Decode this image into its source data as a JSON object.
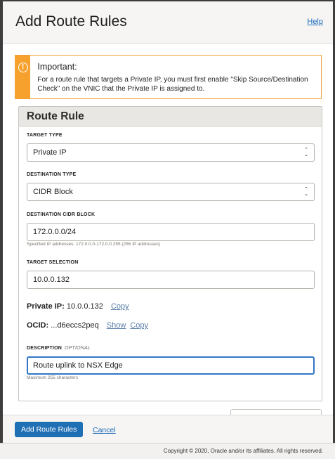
{
  "dialog": {
    "title": "Add Route Rules",
    "help_label": "Help"
  },
  "alert": {
    "icon": "info-circle-icon",
    "heading": "Important:",
    "text": "For a route rule that targets a Private IP, you must first enable \"Skip Source/Destination Check\" on the VNIC that the Private IP is assigned to.",
    "accent_color": "#f6a02d"
  },
  "rule": {
    "title": "Route Rule",
    "target_type": {
      "label": "TARGET TYPE",
      "value": "Private IP"
    },
    "destination_type": {
      "label": "DESTINATION TYPE",
      "value": "CIDR Block"
    },
    "destination_cidr": {
      "label": "DESTINATION CIDR BLOCK",
      "value": "172.0.0.0/24",
      "helper": "Specified IP addresses: 172.0.0.0-172.0.0.255 (256 IP addresses)"
    },
    "target_selection": {
      "label": "TARGET SELECTION",
      "value": "10.0.0.132"
    },
    "private_ip": {
      "label": "Private IP:",
      "value": "10.0.0.132",
      "copy_label": "Copy"
    },
    "ocid": {
      "label": "OCID:",
      "value": "...d6eccs2peq",
      "show_label": "Show",
      "copy_label": "Copy"
    },
    "description": {
      "label": "DESCRIPTION",
      "optional_label": "OPTIONAL",
      "value": "Route uplink to NSX Edge",
      "helper": "Maximum 255 characters"
    }
  },
  "footer": {
    "primary_label": "Add Route Rules",
    "cancel_label": "Cancel",
    "primary_color": "#1f6fb5"
  },
  "page_footer": {
    "copyright": "Copyright © 2020, Oracle and/or its affiliates. All rights reserved."
  }
}
